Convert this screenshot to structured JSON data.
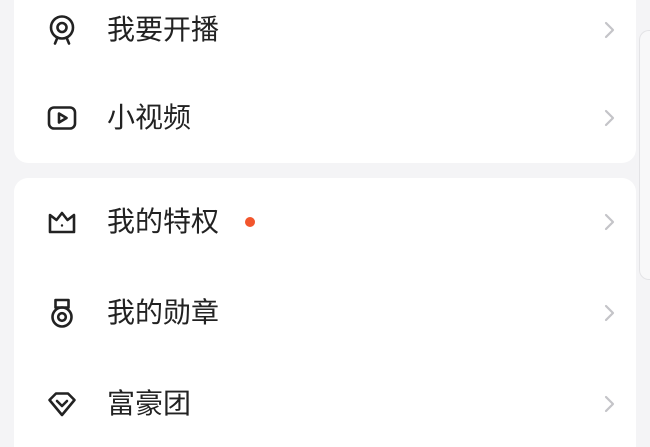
{
  "colors": {
    "background": "#f4f4f6",
    "card": "#ffffff",
    "text": "#222222",
    "chevron": "#c4c4c8",
    "badge_dot": "#f2552c"
  },
  "card_group_1": {
    "items": [
      {
        "label": "我要开播",
        "icon": "webcam-icon"
      },
      {
        "label": "小视频",
        "icon": "play-video-icon"
      }
    ]
  },
  "card_group_2": {
    "items": [
      {
        "label": "我的特权",
        "icon": "crown-icon",
        "badge_dot": true
      },
      {
        "label": "我的勋章",
        "icon": "medal-icon"
      },
      {
        "label": "富豪团",
        "icon": "diamond-icon"
      }
    ]
  }
}
